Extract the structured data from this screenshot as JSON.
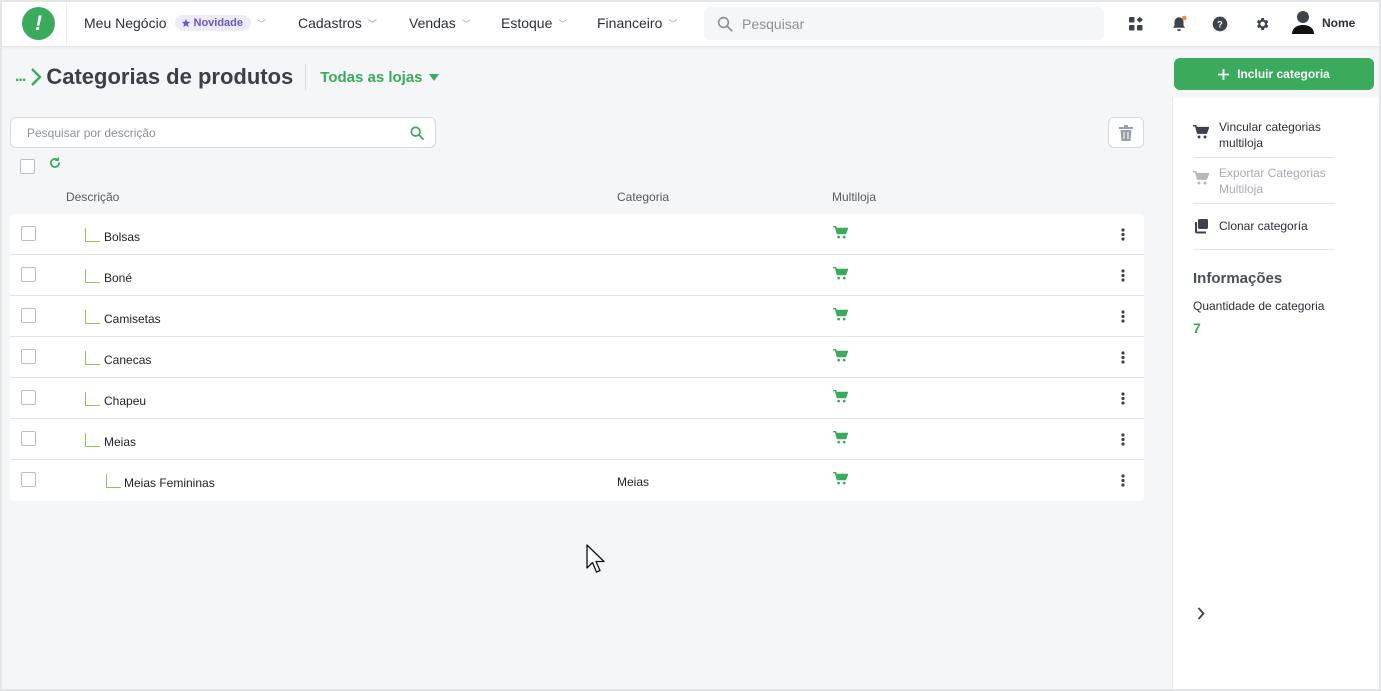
{
  "topbar": {
    "logo_text": "!",
    "business": "Meu Negócio",
    "badge": "Novidade",
    "menu": [
      "Cadastros",
      "Vendas",
      "Estoque",
      "Financeiro"
    ],
    "search_placeholder": "Pesquisar",
    "user_name": "Nome"
  },
  "header": {
    "breadcrumb_dots": "...",
    "title": "Categorias de produtos",
    "store_filter": "Todas as lojas",
    "add_button": "Incluir categoria"
  },
  "filter": {
    "search_placeholder": "Pesquisar por descrição"
  },
  "table": {
    "columns": [
      "Descrição",
      "Categoria",
      "Multiloja"
    ],
    "rows": [
      {
        "description": "Bolsas",
        "category": "",
        "level": 1
      },
      {
        "description": "Boné",
        "category": "",
        "level": 1
      },
      {
        "description": "Camisetas",
        "category": "",
        "level": 1
      },
      {
        "description": "Canecas",
        "category": "",
        "level": 1
      },
      {
        "description": "Chapeu",
        "category": "",
        "level": 1
      },
      {
        "description": "Meias",
        "category": "",
        "level": 1
      },
      {
        "description": "Meias Femininas",
        "category": "Meias",
        "level": 2
      }
    ]
  },
  "panel": {
    "actions": [
      {
        "label": "Vincular categorias multiloja",
        "enabled": true
      },
      {
        "label": "Exportar Categorias Multiloja",
        "enabled": false
      },
      {
        "label": "Clonar categoría",
        "enabled": true
      }
    ],
    "info_title": "Informações",
    "info_label": "Quantidade de categoria",
    "info_value": "7"
  },
  "colors": {
    "accent": "#3aaa5c",
    "badge_bg": "#eeecfb",
    "badge_text": "#6b57c9",
    "notification_dot": "#f28b3c"
  }
}
